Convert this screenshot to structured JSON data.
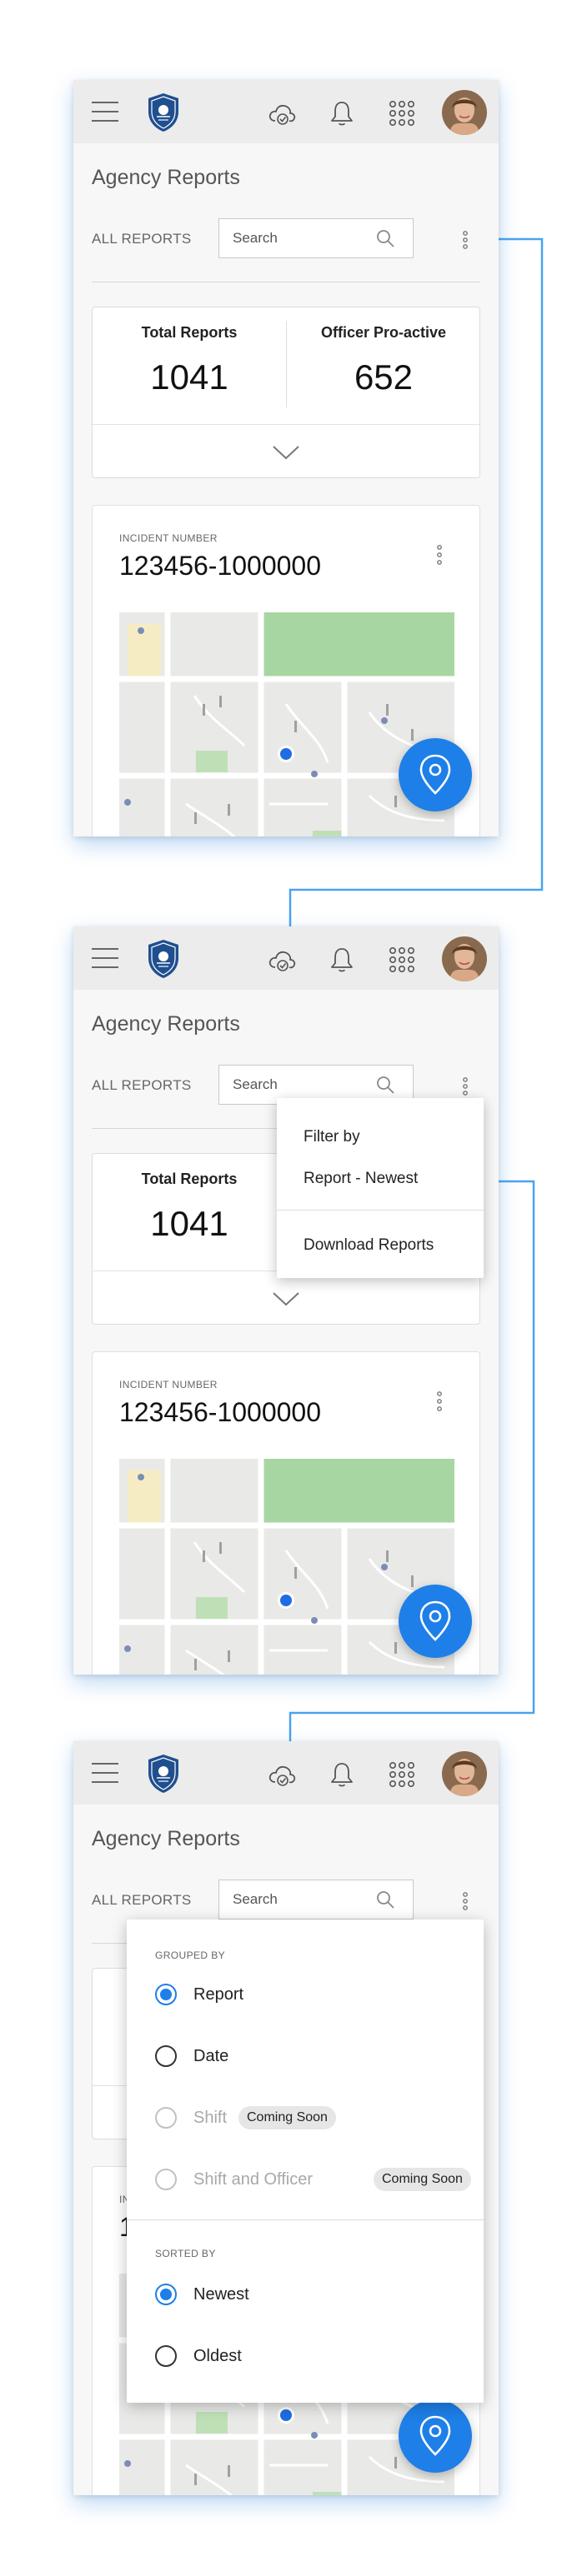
{
  "app": {
    "page_title": "Agency Reports",
    "filter_label": "ALL REPORTS",
    "search_placeholder": "Search"
  },
  "stats": {
    "total_label": "Total Reports",
    "total_value": "1041",
    "proactive_label": "Officer Pro-active",
    "proactive_value": "652"
  },
  "incident": {
    "label": "INCIDENT NUMBER",
    "number": "123456-1000000"
  },
  "menu": {
    "filter_by": "Filter by",
    "current_sort": "Report - Newest",
    "download": "Download Reports"
  },
  "group_panel": {
    "grouped_by_heading": "GROUPED BY",
    "options": [
      {
        "label": "Report",
        "selected": true,
        "disabled": false
      },
      {
        "label": "Date",
        "selected": false,
        "disabled": false
      },
      {
        "label": "Shift",
        "selected": false,
        "disabled": true,
        "badge": "Coming Soon"
      },
      {
        "label": "Shift and Officer",
        "selected": false,
        "disabled": true,
        "badge": "Coming Soon"
      }
    ],
    "sorted_by_heading": "SORTED BY",
    "sort_options": [
      {
        "label": "Newest",
        "selected": true
      },
      {
        "label": "Oldest",
        "selected": false
      }
    ]
  },
  "icons": {
    "menu": "hamburger-icon",
    "logo": "agency-shield-logo",
    "sync": "cloud-sync-icon",
    "notifications": "bell-icon",
    "apps": "apps-grid-icon",
    "search": "search-icon",
    "more": "kebab-icon",
    "expand": "chevron-down-icon",
    "location": "location-pin-icon"
  },
  "colors": {
    "accent": "#1e7fe8",
    "connector": "#4aa3f0",
    "topbar": "#ececec",
    "logo_blue": "#1f4f8f"
  }
}
